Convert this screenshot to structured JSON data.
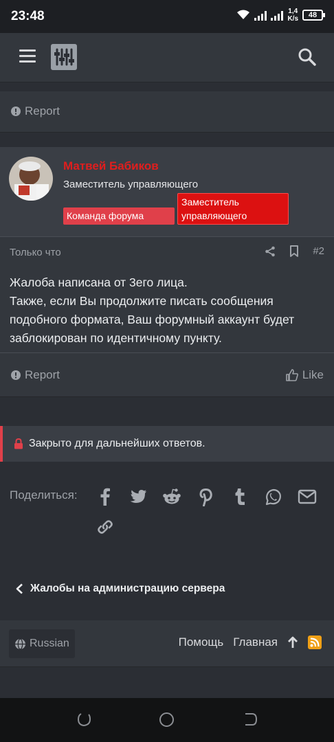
{
  "status": {
    "time": "23:48",
    "net_speed_value": "1,4",
    "net_speed_unit": "K/s",
    "battery": "48"
  },
  "header": {
    "menu_icon": "hamburger-icon",
    "logo_icon": "sliders-logo-icon",
    "search_icon": "search-icon"
  },
  "post1": {
    "report_label": "Report"
  },
  "post2": {
    "username": "Матвей Бабиков",
    "user_title": "Заместитель управляющего",
    "banner1": "Команда форума",
    "banner2": "Заместитель управляющего",
    "date": "Только что",
    "number": "#2",
    "body": [
      "Жалоба написана от 3его лица.",
      "Также, если Вы продолжите писать сообщения подобного формата, Ваш форумный аккаунт будет заблокирован по идентичному пункту."
    ],
    "report_label": "Report",
    "like_label": "Like"
  },
  "closed_notice": "Закрыто для дальнейших ответов.",
  "share": {
    "label": "Поделиться:",
    "icons": [
      "facebook-icon",
      "twitter-icon",
      "reddit-icon",
      "pinterest-icon",
      "tumblr-icon",
      "whatsapp-icon",
      "email-icon",
      "link-icon"
    ]
  },
  "breadcrumb": "Жалобы на администрацию сервера",
  "footer": {
    "language": "Russian",
    "help": "Помощь",
    "home": "Главная"
  },
  "colors": {
    "username": "#e01e1e",
    "banner1": "#e0404a",
    "banner2": "#dc1111",
    "rss": "#f0a016"
  }
}
